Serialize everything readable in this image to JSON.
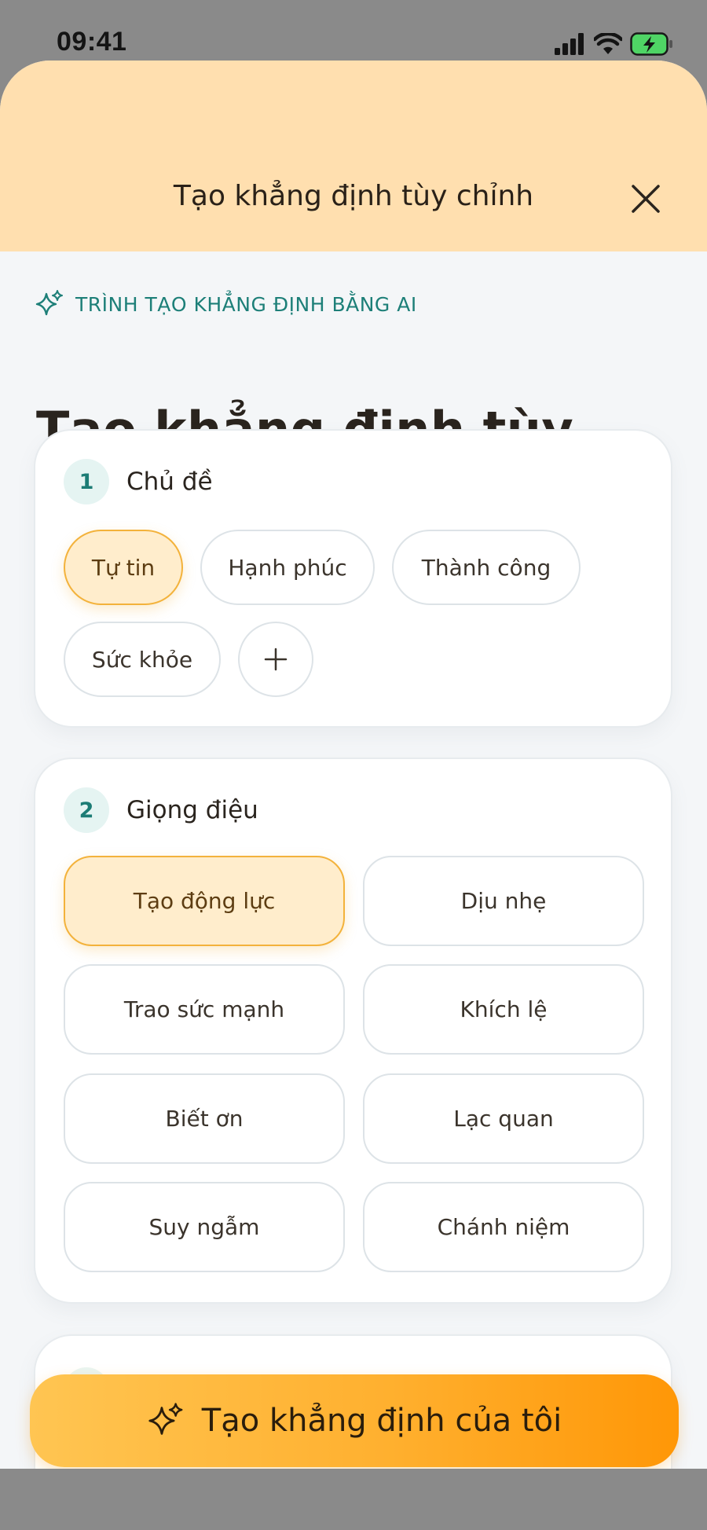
{
  "status_bar": {
    "time": "09:41"
  },
  "sheet": {
    "header_title": "Tạo khẳng định tùy chỉnh"
  },
  "eyebrow": {
    "label": "TRÌNH TẠO KHẲNG ĐỊNH BẰNG AI",
    "icon": "sparkles-icon"
  },
  "page_title": "Tạo khẳng định tùy chỉnh",
  "topic_section": {
    "number": "1",
    "label": "Chủ đề",
    "chips": [
      {
        "label": "Tự tin",
        "selected": true
      },
      {
        "label": "Hạnh phúc",
        "selected": false
      },
      {
        "label": "Thành công",
        "selected": false
      },
      {
        "label": "Sức khỏe",
        "selected": false
      }
    ],
    "add_icon": "plus-icon"
  },
  "tone_section": {
    "number": "2",
    "label": "Giọng điệu",
    "options": [
      {
        "label": "Tạo động lực",
        "selected": true
      },
      {
        "label": "Dịu nhẹ",
        "selected": false
      },
      {
        "label": "Trao sức mạnh",
        "selected": false
      },
      {
        "label": "Khích lệ",
        "selected": false
      },
      {
        "label": "Biết ơn",
        "selected": false
      },
      {
        "label": "Lạc quan",
        "selected": false
      },
      {
        "label": "Suy ngẫm",
        "selected": false
      },
      {
        "label": "Chánh niệm",
        "selected": false
      }
    ]
  },
  "cta": {
    "label": "Tạo khẳng định của tôi",
    "icon": "sparkles-icon"
  },
  "colors": {
    "accent_orange": "#ff9707",
    "accent_yellow": "#ffc552",
    "selected_fill": "#ffedcc",
    "selected_border": "#f3b23b",
    "teal": "#1d7f78",
    "header_bg": "#ffdfaf"
  }
}
